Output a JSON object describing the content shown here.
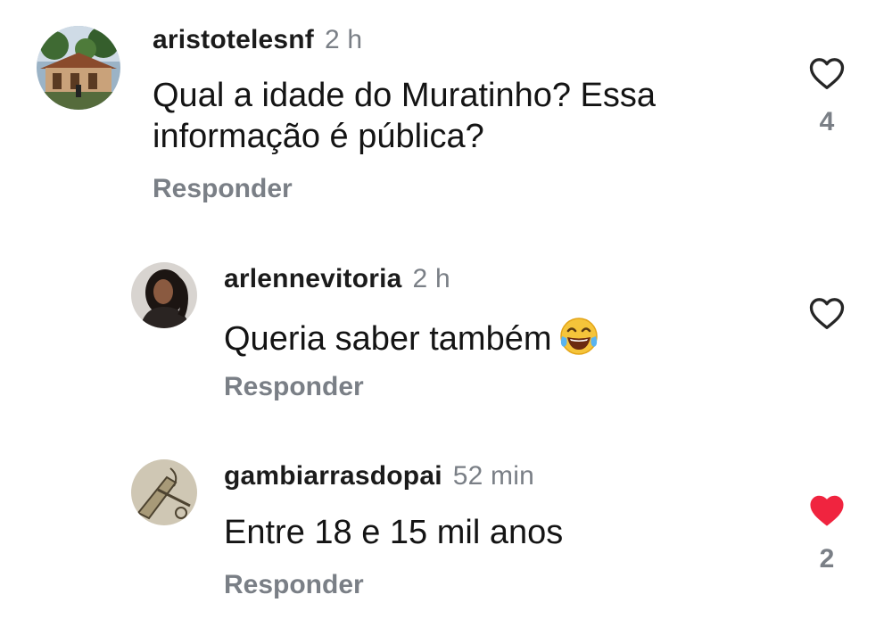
{
  "comments": [
    {
      "username": "aristotelesnf",
      "time": "2 h",
      "text_line1": "Qual a idade do Muratinho? Essa",
      "text_line2": "informação é pública?",
      "reply_label": "Responder",
      "likes": "4",
      "liked": false,
      "avatar": "house-photo"
    },
    {
      "username": "arlennevitoria",
      "time": "2 h",
      "text": "Queria saber também",
      "emoji": "face-with-tears-of-joy",
      "reply_label": "Responder",
      "likes": "",
      "liked": false,
      "avatar": "woman-portrait"
    },
    {
      "username": "gambiarrasdopai",
      "time": "52 min",
      "text": "Entre 18 e 15 mil anos",
      "reply_label": "Responder",
      "likes": "2",
      "liked": true,
      "avatar": "sketch-drawing"
    }
  ],
  "colors": {
    "liked_heart": "#f0243f",
    "muted_text": "#7a7f86",
    "outline_heart": "#262626"
  }
}
